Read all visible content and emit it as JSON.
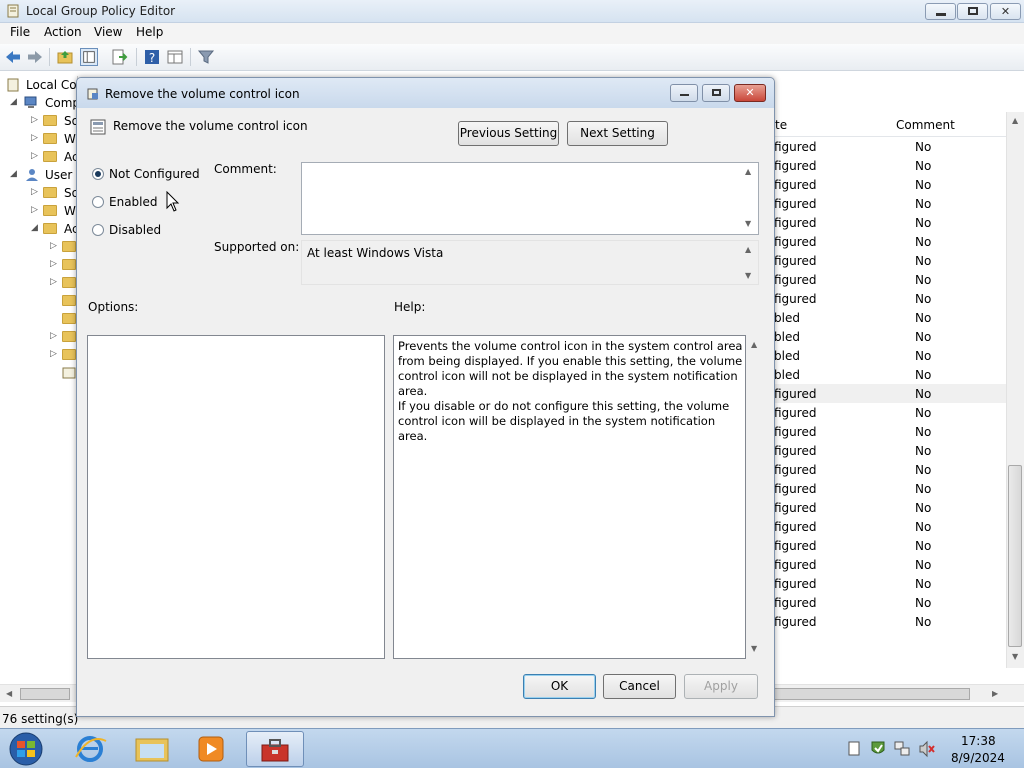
{
  "window": {
    "title": "Local Group Policy Editor"
  },
  "menu": [
    "File",
    "Action",
    "View",
    "Help"
  ],
  "tree": {
    "rows": [
      {
        "label": "Local Cor"
      },
      {
        "label": "Comp"
      },
      {
        "label": "So"
      },
      {
        "label": "W"
      },
      {
        "label": "Ac"
      },
      {
        "label": "User C"
      },
      {
        "label": "So"
      },
      {
        "label": "W"
      },
      {
        "label": "Ac"
      }
    ]
  },
  "list": {
    "header": {
      "state": "te",
      "comment": "Comment"
    },
    "rows": [
      {
        "state": "figured",
        "comment": "No"
      },
      {
        "state": "figured",
        "comment": "No"
      },
      {
        "state": "figured",
        "comment": "No"
      },
      {
        "state": "figured",
        "comment": "No"
      },
      {
        "state": "figured",
        "comment": "No"
      },
      {
        "state": "figured",
        "comment": "No"
      },
      {
        "state": "figured",
        "comment": "No"
      },
      {
        "state": "figured",
        "comment": "No"
      },
      {
        "state": "figured",
        "comment": "No"
      },
      {
        "state": "bled",
        "comment": "No"
      },
      {
        "state": "bled",
        "comment": "No"
      },
      {
        "state": "bled",
        "comment": "No"
      },
      {
        "state": "bled",
        "comment": "No"
      },
      {
        "state": "figured",
        "comment": "No"
      },
      {
        "state": "figured",
        "comment": "No"
      },
      {
        "state": "figured",
        "comment": "No"
      },
      {
        "state": "figured",
        "comment": "No"
      },
      {
        "state": "figured",
        "comment": "No"
      },
      {
        "state": "figured",
        "comment": "No"
      },
      {
        "state": "figured",
        "comment": "No"
      },
      {
        "state": "figured",
        "comment": "No"
      },
      {
        "state": "figured",
        "comment": "No"
      },
      {
        "state": "figured",
        "comment": "No"
      },
      {
        "state": "figured",
        "comment": "No"
      },
      {
        "state": "figured",
        "comment": "No"
      },
      {
        "state": "figured",
        "comment": "No"
      }
    ],
    "selected_index": 13
  },
  "status": {
    "text": "76 setting(s)"
  },
  "dialog": {
    "title": "Remove the volume control icon",
    "setting_name": "Remove the volume control icon",
    "prev_button": "Previous Setting",
    "next_button": "Next Setting",
    "radios": [
      "Not Configured",
      "Enabled",
      "Disabled"
    ],
    "selected_radio": "Not Configured",
    "comment_label": "Comment:",
    "comment_value": "",
    "supported_label": "Supported on:",
    "supported_value": "At least Windows Vista",
    "options_label": "Options:",
    "help_label": "Help:",
    "help_text_p1": "Prevents the volume control icon in the system control area from being displayed. If you enable this setting, the volume control icon will not be displayed in the system notification area.",
    "help_text_p2": "If you disable or do not configure this setting, the volume control icon will be displayed in the system notification area.",
    "ok_button": "OK",
    "cancel_button": "Cancel",
    "apply_button": "Apply"
  },
  "taskbar": {
    "time": "17:38",
    "date": "8/9/2024"
  },
  "colors": {
    "accent": "#3c7fb1",
    "titlebar": "#d6e3f1",
    "taskbar": "#b5cde8",
    "close": "#c9473a"
  }
}
